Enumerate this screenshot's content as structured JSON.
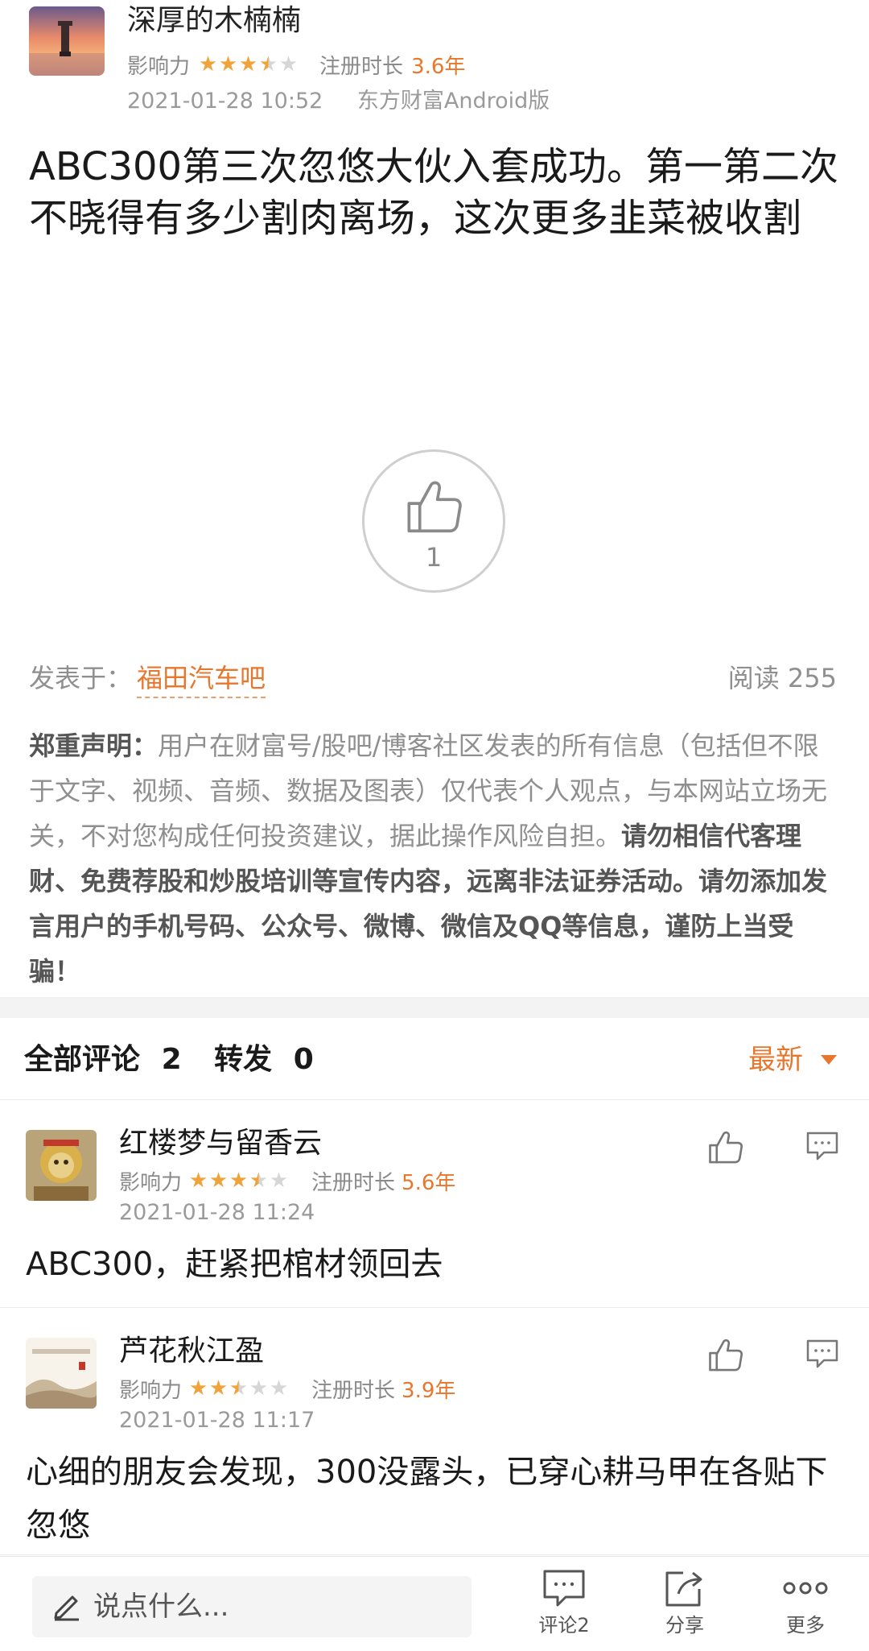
{
  "author": {
    "name": "深厚的木楠楠",
    "influence_label": "影响力",
    "influence_rating": 3.5,
    "reg_label": "注册时长",
    "reg_value": "3.6年",
    "time": "2021-01-28 10:52",
    "source": "东方财富Android版"
  },
  "post": {
    "body": "ABC300第三次忽悠大伙入套成功。第一第二次不晓得有多少割肉离场，这次更多韭菜被收割",
    "like_count": "1",
    "posted_in_label": "发表于：",
    "bar_name": "福田汽车吧",
    "reads": "阅读 255"
  },
  "disclaimer": {
    "label": "郑重声明：",
    "text": "用户在财富号/股吧/博客社区发表的所有信息（包括但不限于文字、视频、音频、数据及图表）仅代表个人观点，与本网站立场无关，不对您构成任何投资建议，据此操作风险自担。",
    "warning": "请勿相信代客理财、免费荐股和炒股培训等宣传内容，远离非法证券活动。请勿添加发言用户的手机号码、公众号、微博、微信及QQ等信息，谨防上当受骗！"
  },
  "comments_header": {
    "all_label": "全部评论",
    "all_count": "2",
    "repost_label": "转发",
    "repost_count": "0",
    "sort": "最新"
  },
  "comments": [
    {
      "name": "红楼梦与留香云",
      "influence_label": "影响力",
      "influence_rating": 3.5,
      "reg_label": "注册时长",
      "reg_value": "5.6年",
      "time": "2021-01-28 11:24",
      "text": "ABC300，赶紧把棺材领回去"
    },
    {
      "name": "芦花秋江盈",
      "influence_label": "影响力",
      "influence_rating": 2.5,
      "reg_label": "注册时长",
      "reg_value": "3.9年",
      "time": "2021-01-28 11:17",
      "text": "心细的朋友会发现，300没露头，已穿心耕马甲在各贴下忽悠"
    }
  ],
  "bottom_bar": {
    "input_placeholder": "说点什么...",
    "comment_label": "评论2",
    "share_label": "分享",
    "more_label": "更多"
  },
  "colors": {
    "accent": "#e8772e",
    "star": "#f0a33a",
    "muted_text": "#8f8f8f"
  },
  "icons": [
    "edit-pen-icon",
    "thumbs-up-icon",
    "comment-bubble-icon",
    "share-icon",
    "more-dots-icon",
    "sort-caret-icon"
  ]
}
